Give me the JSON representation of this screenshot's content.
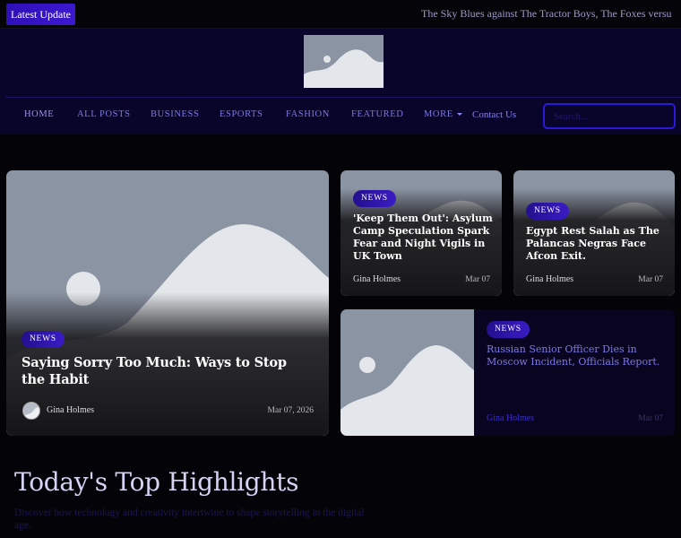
{
  "topbar": {
    "latest_label": "Latest Update",
    "ticker_text": "The Sky Blues against The Tractor Boys, The Foxes versus The Canaries"
  },
  "header": {
    "logo_icon": "image-placeholder-icon"
  },
  "nav": {
    "items": [
      {
        "label": "HOME"
      },
      {
        "label": "ALL POSTS"
      },
      {
        "label": "BUSINESS"
      },
      {
        "label": "ESPORTS"
      },
      {
        "label": "FASHION"
      },
      {
        "label": "FEATURED"
      },
      {
        "label": "MORE"
      },
      {
        "label": "Contact Us"
      }
    ],
    "search_placeholder": "Search..."
  },
  "posts": [
    {
      "badge": "NEWS",
      "title": "Saying Sorry Too Much: Ways to Stop the Habit",
      "author": "Gina Holmes",
      "date": "Mar 07, 2026"
    },
    {
      "badge": "NEWS",
      "title": "'Keep Them Out': Asylum Camp Speculation Spark Fear and Night Vigils in UK Town",
      "author": "Gina Holmes",
      "date": "Mar 07"
    },
    {
      "badge": "NEWS",
      "title": "Egypt Rest Salah as The Palancas Negras Face Afcon Exit.",
      "author": "Gina Holmes",
      "date": "Mar 07"
    },
    {
      "badge": "NEWS",
      "title": "Russian Senior Officer Dies in Moscow Incident, Officials Report.",
      "author": "Gina Holmes",
      "date": "Mar 07"
    }
  ],
  "section": {
    "title": "Today's Top Highlights",
    "subtitle": "Discover how technology and creativity intertwine to shape storytelling in the digital age."
  },
  "colors": {
    "accent": "#3a1cc4",
    "header_bg": "#08042a",
    "page_bg": "#040308",
    "nav_text": "#7c7ae6"
  }
}
